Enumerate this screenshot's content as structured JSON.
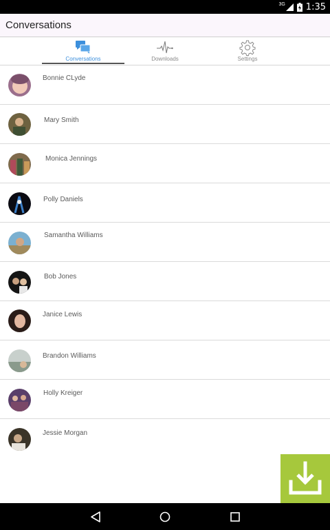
{
  "status_bar": {
    "network": "3G",
    "time": "1:35",
    "icons": [
      "signal-icon",
      "battery-icon"
    ]
  },
  "app_bar": {
    "title": "Conversations"
  },
  "tabs": [
    {
      "label": "Conversations",
      "icon": "chat-bubbles-icon",
      "active": true
    },
    {
      "label": "Downloads",
      "icon": "pulse-icon",
      "active": false
    },
    {
      "label": "Settings",
      "icon": "gear-icon",
      "active": false
    }
  ],
  "colors": {
    "accent": "#3c8fdc",
    "fab": "#a6c83c",
    "app_bar_bg": "#fbf6fc"
  },
  "conversations": [
    {
      "name": "Bonnie CLyde"
    },
    {
      "name": "Mary Smith"
    },
    {
      "name": "Monica Jennings"
    },
    {
      "name": "Polly Daniels"
    },
    {
      "name": "Samantha Williams"
    },
    {
      "name": "Bob Jones"
    },
    {
      "name": "Janice Lewis"
    },
    {
      "name": "Brandon Williams"
    },
    {
      "name": "Holly Kreiger"
    },
    {
      "name": "Jessie Morgan"
    }
  ],
  "fab": {
    "icon": "download-icon"
  },
  "nav_bar": {
    "icons": [
      "back-icon",
      "home-icon",
      "recents-icon"
    ]
  }
}
